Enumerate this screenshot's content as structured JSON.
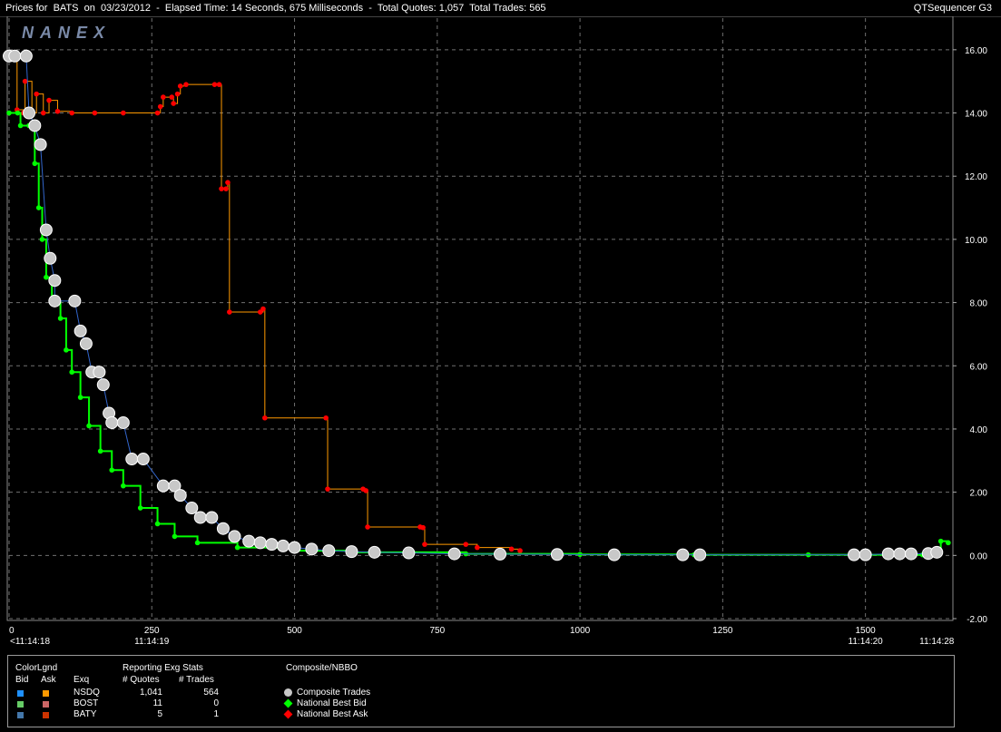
{
  "window": {
    "title": "Prices for  BATS  on  03/23/2012  -  Elapsed Time: 14 Seconds, 675 Milliseconds  -  Total Quotes: 1,057  Total Trades: 565",
    "app_name": "QTSequencer G3"
  },
  "logo": "NANEX",
  "chart_data": {
    "type": "scatter",
    "title": "",
    "xlabel": "",
    "ylabel": "",
    "xlim": [
      0,
      1650
    ],
    "ylim": [
      -2.0,
      17.0
    ],
    "x_ticks": [
      0,
      250,
      500,
      750,
      1000,
      1250,
      1500
    ],
    "y_ticks": [
      16,
      14,
      12,
      10,
      8,
      6,
      4,
      2,
      0,
      -2
    ],
    "y_tick_labels": [
      "16.00",
      "14.00",
      "12.00",
      "10.00",
      "8.00",
      "6.00",
      "4.00",
      "2.00",
      "0.00",
      "-2.00"
    ],
    "time_labels": [
      {
        "x": 0,
        "label": "<11:14:18"
      },
      {
        "x": 250,
        "label": "11:14:19"
      },
      {
        "x": 1500,
        "label": "11:14:20"
      },
      {
        "x": 1625,
        "label": "11:14:28"
      }
    ],
    "grid": true,
    "series": [
      {
        "name": "National Best Ask",
        "color": "#ff0000",
        "line_color": "#ff9900",
        "points": [
          [
            0,
            15.9
          ],
          [
            10,
            15.9
          ],
          [
            14,
            14.1
          ],
          [
            25,
            14.0
          ],
          [
            28,
            15.0
          ],
          [
            40,
            14.0
          ],
          [
            48,
            14.6
          ],
          [
            60,
            14.0
          ],
          [
            70,
            14.4
          ],
          [
            85,
            14.05
          ],
          [
            110,
            14.0
          ],
          [
            150,
            14.0
          ],
          [
            200,
            14.0
          ],
          [
            260,
            14.0
          ],
          [
            265,
            14.2
          ],
          [
            270,
            14.5
          ],
          [
            285,
            14.5
          ],
          [
            288,
            14.3
          ],
          [
            295,
            14.6
          ],
          [
            300,
            14.85
          ],
          [
            310,
            14.9
          ],
          [
            360,
            14.9
          ],
          [
            368,
            14.9
          ],
          [
            372,
            11.6
          ],
          [
            380,
            11.6
          ],
          [
            383,
            11.8
          ],
          [
            386,
            7.7
          ],
          [
            440,
            7.7
          ],
          [
            445,
            7.8
          ],
          [
            448,
            4.35
          ],
          [
            555,
            4.35
          ],
          [
            558,
            2.1
          ],
          [
            620,
            2.1
          ],
          [
            625,
            2.05
          ],
          [
            628,
            0.9
          ],
          [
            720,
            0.9
          ],
          [
            725,
            0.88
          ],
          [
            728,
            0.35
          ],
          [
            800,
            0.35
          ],
          [
            820,
            0.25
          ],
          [
            880,
            0.2
          ],
          [
            895,
            0.15
          ]
        ]
      },
      {
        "name": "National Best Bid",
        "color": "#00ff00",
        "line_color": "#00ff00",
        "points": [
          [
            0,
            14.0
          ],
          [
            15,
            14.0
          ],
          [
            20,
            13.6
          ],
          [
            35,
            13.6
          ],
          [
            45,
            12.4
          ],
          [
            52,
            11.0
          ],
          [
            58,
            10.0
          ],
          [
            65,
            8.8
          ],
          [
            75,
            8.0
          ],
          [
            90,
            7.5
          ],
          [
            100,
            6.5
          ],
          [
            110,
            5.8
          ],
          [
            125,
            5.0
          ],
          [
            140,
            4.1
          ],
          [
            160,
            3.3
          ],
          [
            180,
            2.7
          ],
          [
            200,
            2.2
          ],
          [
            230,
            1.5
          ],
          [
            260,
            1.0
          ],
          [
            290,
            0.6
          ],
          [
            330,
            0.4
          ],
          [
            400,
            0.25
          ],
          [
            500,
            0.15
          ],
          [
            600,
            0.1
          ],
          [
            800,
            0.05
          ],
          [
            1000,
            0.03
          ],
          [
            1200,
            0.02
          ],
          [
            1400,
            0.02
          ],
          [
            1600,
            0.02
          ],
          [
            1628,
            0.1
          ],
          [
            1632,
            0.45
          ],
          [
            1645,
            0.4
          ]
        ]
      },
      {
        "name": "Composite Trades",
        "color": "#c8c8c8",
        "points": [
          [
            0,
            15.8
          ],
          [
            10,
            15.8
          ],
          [
            30,
            15.8
          ],
          [
            35,
            14.0
          ],
          [
            45,
            13.6
          ],
          [
            55,
            13.0
          ],
          [
            65,
            10.3
          ],
          [
            72,
            9.4
          ],
          [
            80,
            8.7
          ],
          [
            80,
            8.05
          ],
          [
            115,
            8.05
          ],
          [
            125,
            7.1
          ],
          [
            135,
            6.7
          ],
          [
            145,
            5.8
          ],
          [
            158,
            5.8
          ],
          [
            165,
            5.4
          ],
          [
            175,
            4.5
          ],
          [
            180,
            4.2
          ],
          [
            200,
            4.2
          ],
          [
            215,
            3.05
          ],
          [
            235,
            3.05
          ],
          [
            270,
            2.2
          ],
          [
            290,
            2.2
          ],
          [
            300,
            1.9
          ],
          [
            320,
            1.5
          ],
          [
            335,
            1.2
          ],
          [
            355,
            1.2
          ],
          [
            375,
            0.85
          ],
          [
            395,
            0.6
          ],
          [
            420,
            0.45
          ],
          [
            440,
            0.4
          ],
          [
            460,
            0.35
          ],
          [
            480,
            0.3
          ],
          [
            500,
            0.25
          ],
          [
            530,
            0.2
          ],
          [
            560,
            0.15
          ],
          [
            600,
            0.12
          ],
          [
            640,
            0.1
          ],
          [
            700,
            0.08
          ],
          [
            780,
            0.05
          ],
          [
            860,
            0.04
          ],
          [
            960,
            0.03
          ],
          [
            1060,
            0.02
          ],
          [
            1180,
            0.02
          ],
          [
            1210,
            0.02
          ],
          [
            1480,
            0.02
          ],
          [
            1500,
            0.02
          ],
          [
            1540,
            0.05
          ],
          [
            1560,
            0.05
          ],
          [
            1580,
            0.05
          ],
          [
            1610,
            0.06
          ],
          [
            1625,
            0.1
          ]
        ]
      }
    ]
  },
  "legend": {
    "colorlgnd_label": "ColorLgnd",
    "bid_header": "Bid",
    "ask_header": "Ask",
    "exq_header": "Exq",
    "reporting_label": "Reporting Exg Stats",
    "quotes_header": "# Quotes",
    "trades_header": "# Trades",
    "composite_label": "Composite/NBBO",
    "rows": [
      {
        "exq": "NSDQ",
        "quotes": "1,041",
        "trades": "564",
        "bid_color": "#1e90ff",
        "ask_color": "#ff9900"
      },
      {
        "exq": "BOST",
        "quotes": "11",
        "trades": "0",
        "bid_color": "#66cc66",
        "ask_color": "#cc6666"
      },
      {
        "exq": "BATY",
        "quotes": "5",
        "trades": "1",
        "bid_color": "#4477aa",
        "ask_color": "#cc3300"
      }
    ],
    "keys": [
      {
        "label": "Composite Trades",
        "color": "#c8c8c8"
      },
      {
        "label": "National Best Bid",
        "color": "#00ff00"
      },
      {
        "label": "National Best Ask",
        "color": "#ff0000"
      }
    ]
  }
}
